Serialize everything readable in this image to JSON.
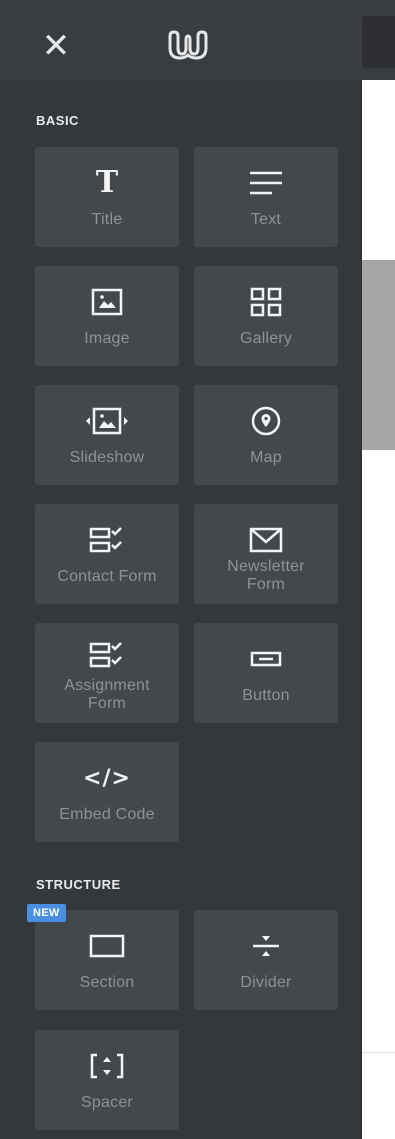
{
  "header": {
    "close_icon": "close-icon",
    "logo_icon": "weebly-logo-icon"
  },
  "sections": {
    "basic_label": "BASIC",
    "structure_label": "STRUCTURE"
  },
  "basic_items": {
    "title": "Title",
    "text": "Text",
    "image": "Image",
    "gallery": "Gallery",
    "slideshow": "Slideshow",
    "map": "Map",
    "contact_form": "Contact Form",
    "newsletter_form_1": "Newsletter",
    "newsletter_form_2": "Form",
    "assignment_form_1": "Assignment",
    "assignment_form_2": "Form",
    "button": "Button",
    "embed_code": "Embed Code"
  },
  "structure_items": {
    "section": "Section",
    "section_badge": "NEW",
    "divider": "Divider",
    "spacer": "Spacer"
  },
  "colors": {
    "panel_bg": "#35383b",
    "tile_bg": "#45484b",
    "badge_bg": "#4a90e2"
  }
}
